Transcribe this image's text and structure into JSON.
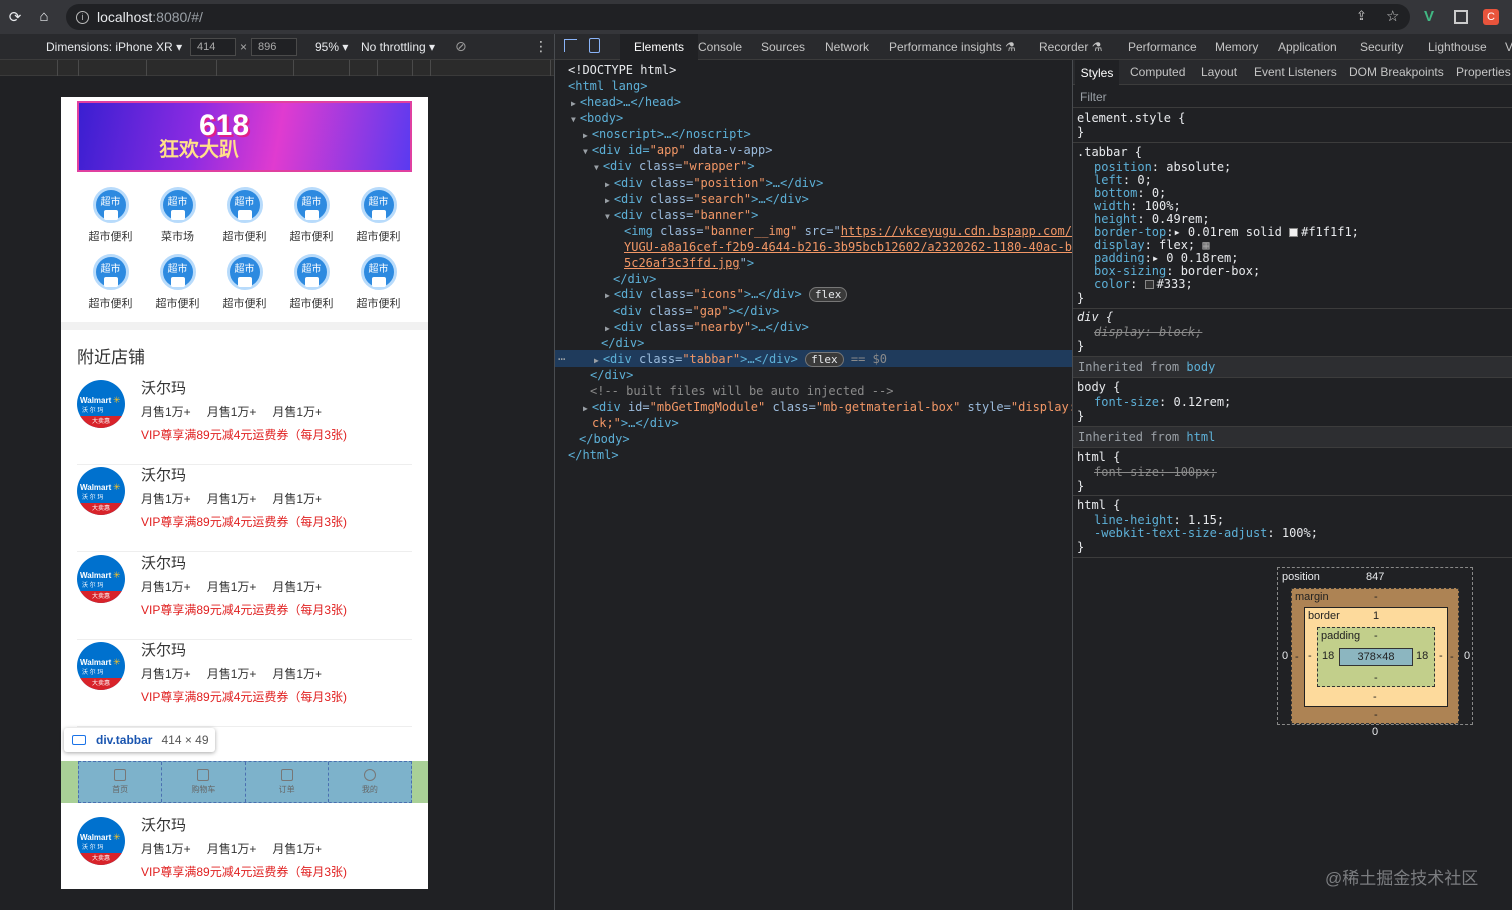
{
  "browser": {
    "url_host": "localhost",
    "url_rest": ":8080/#/",
    "ext_v": "V",
    "ext_c": "C"
  },
  "device_toolbar": {
    "dimensions_label": "Dimensions: iPhone XR",
    "width": "414",
    "times": "×",
    "height": "896",
    "zoom": "95%",
    "throttling": "No throttling"
  },
  "phone": {
    "banner_text": "618",
    "banner_subtext": "狂欢大趴",
    "icon_badge": "超市",
    "icons_row1": [
      "超市便利",
      "菜市场",
      "超市便利",
      "超市便利",
      "超市便利"
    ],
    "icons_row2": [
      "超市便利",
      "超市便利",
      "超市便利",
      "超市便利",
      "超市便利"
    ],
    "nearby_title": "附近店铺",
    "shops": [
      {
        "name": "沃尔玛",
        "sales": [
          "月售1万+",
          "月售1万+",
          "月售1万+"
        ],
        "vip": "VIP尊享满89元减4元运费券（每月3张)"
      },
      {
        "name": "沃尔玛",
        "sales": [
          "月售1万+",
          "月售1万+",
          "月售1万+"
        ],
        "vip": "VIP尊享满89元减4元运费券（每月3张)"
      },
      {
        "name": "沃尔玛",
        "sales": [
          "月售1万+",
          "月售1万+",
          "月售1万+"
        ],
        "vip": "VIP尊享满89元减4元运费券（每月3张)"
      },
      {
        "name": "沃尔玛",
        "sales": [
          "月售1万+",
          "月售1万+",
          "月售1万+"
        ],
        "vip": "VIP尊享满89元减4元运费券（每月3张)"
      },
      {
        "name": "沃尔玛",
        "sales": [
          "月售1万+",
          "月售1万+",
          "月售1万+"
        ],
        "vip": "VIP尊享满89元减4元运费券（每月3张)"
      }
    ],
    "shop_logo_text": "Walmart",
    "shop_logo_sub": "沃 尔 玛",
    "shop_logo_red": "大卖惠",
    "tabs": [
      "首页",
      "购物车",
      "订单",
      "我的"
    ],
    "tooltip_name": "div.tabbar",
    "tooltip_size": "414 × 49"
  },
  "devtools_tabs": [
    "Elements",
    "Console",
    "Sources",
    "Network",
    "Performance insights",
    "Recorder",
    "Performance",
    "Memory",
    "Application",
    "Security",
    "Lighthouse",
    "V"
  ],
  "elements": {
    "doctype": "<!DOCTYPE html>",
    "html_open": "<html lang>",
    "head": "<head>…</head>",
    "body_open": "<body>",
    "noscript": "<noscript>…</noscript>",
    "app_div_tag": "<div id=",
    "app_id": "\"app\"",
    "app_rest": " data-v-app>",
    "wrapper": "\"wrapper\"",
    "position": "\"position\"",
    "search": "\"search\"",
    "banner": "\"banner\"",
    "img_class": "\"banner__img\"",
    "img_src_1": "https://vkceyugu.cdn.bspapp.com/VKCE",
    "img_src_2": "YUGU-a8a16cef-f2b9-4644-b216-3b95bcb12602/a2320262-1180-40ac-b9ca-",
    "img_src_3": "5c26af3c3ffd.jpg",
    "icons": "\"icons\"",
    "gap": "\"gap\"",
    "nearby": "\"nearby\"",
    "tabbar": "\"tabbar\"",
    "flex_badge": "flex",
    "dollar0": "== $0",
    "comment": "<!-- built files will be auto injected -->",
    "mb_id": "\"mbGetImgModule\"",
    "mb_class": "\"mb-getmaterial-box\"",
    "mb_style": "\"display: blo",
    "mb_style2": "ck;\"",
    "body_close": "</body>",
    "html_close": "</html>"
  },
  "styles_tabs": [
    "Styles",
    "Computed",
    "Layout",
    "Event Listeners",
    "DOM Breakpoints",
    "Properties"
  ],
  "styles": {
    "filter_placeholder": "Filter",
    "element_style": "element.style {",
    "tabbar_selector": ".tabbar {",
    "tabbar_props": [
      {
        "p": "position",
        "v": "absolute;"
      },
      {
        "p": "left",
        "v": "0;"
      },
      {
        "p": "bottom",
        "v": "0;"
      },
      {
        "p": "width",
        "v": "100%;"
      },
      {
        "p": "height",
        "v": "0.49rem;"
      },
      {
        "p": "border-top",
        "v": "▸ 0.01rem solid"
      },
      {
        "p": "display",
        "v": "flex;"
      },
      {
        "p": "padding",
        "v": "▸ 0 0.18rem;"
      },
      {
        "p": "box-sizing",
        "v": "border-box;"
      },
      {
        "p": "color",
        "v": "#333;"
      }
    ],
    "border_color": "#f1f1f1;",
    "div_selector": "div {",
    "div_prop": "display: block;",
    "inherited_body": "Inherited from",
    "inherited_body_tag": "body",
    "body_selector": "body {",
    "body_prop": "font-size",
    "body_val": "0.12rem;",
    "inherited_html_tag": "html",
    "html_selector": "html {",
    "html_strike": "font-size: 100px;",
    "html2_p1": "line-height",
    "html2_v1": "1.15;",
    "html2_p2": "-webkit-text-size-adjust",
    "html2_v2": "100%;",
    "close": "}"
  },
  "box_model": {
    "position_label": "position",
    "position_val": "847",
    "margin_label": "margin",
    "border_label": "border",
    "border_val": "1",
    "padding_label": "padding",
    "dash": "-",
    "left_pad": "18",
    "right_pad": "18",
    "content": "378×48",
    "zero": "0"
  },
  "watermark": "@稀土掘金技术社区"
}
